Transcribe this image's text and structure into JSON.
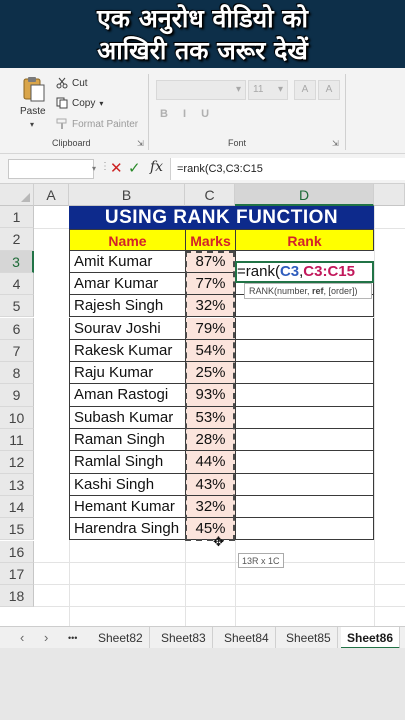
{
  "banner": {
    "line1": "एक अनुरोध वीडियो को",
    "line2": "आखिरी तक जरूर देखें"
  },
  "ribbon": {
    "paste_label": "Paste",
    "cut_label": "Cut",
    "copy_label": "Copy",
    "format_painter_label": "Format Painter",
    "clipboard_group": "Clipboard",
    "font_size": "11",
    "font_group": "Font",
    "font_icons": "B I U"
  },
  "formula_bar": {
    "formula": "=rank(C3,C3:C15",
    "fx_label": "fx"
  },
  "columns": [
    "A",
    "B",
    "C",
    "D"
  ],
  "rows": [
    "1",
    "2",
    "3",
    "4",
    "5",
    "6",
    "7",
    "8",
    "9",
    "10",
    "11",
    "12",
    "13",
    "14",
    "15",
    "16",
    "17",
    "18"
  ],
  "sheet": {
    "title": "USING RANK FUNCTION",
    "headers": {
      "name": "Name",
      "marks": "Marks",
      "rank": "Rank"
    },
    "records": [
      {
        "name": "Amit Kumar",
        "marks": "87%"
      },
      {
        "name": "Amar Kumar",
        "marks": "77%"
      },
      {
        "name": "Rajesh Singh",
        "marks": "32%"
      },
      {
        "name": "Sourav Joshi",
        "marks": "79%"
      },
      {
        "name": "Rakesk Kumar",
        "marks": "54%"
      },
      {
        "name": "Raju Kumar",
        "marks": "25%"
      },
      {
        "name": "Aman Rastogi",
        "marks": "93%"
      },
      {
        "name": "Subash Kumar",
        "marks": "53%"
      },
      {
        "name": "Raman Singh",
        "marks": "28%"
      },
      {
        "name": "Ramlal Singh",
        "marks": "44%"
      },
      {
        "name": "Kashi Singh",
        "marks": "43%"
      },
      {
        "name": "Hemant Kumar",
        "marks": "32%"
      },
      {
        "name": "Harendra Singh",
        "marks": "45%"
      }
    ],
    "active_formula": {
      "prefix": "=rank(",
      "ref1": "C3",
      "comma": ",",
      "ref2": "C3:C15"
    },
    "tooltip": {
      "fn": "RANK(number, ",
      "ref": "ref",
      "rest": ", [order])"
    },
    "selection_size": "13R x 1C"
  },
  "tabs": {
    "ellipsis": "•••",
    "sheets": [
      "Sheet82",
      "Sheet83",
      "Sheet84",
      "Sheet85",
      "Sheet86"
    ],
    "active": "Sheet86"
  },
  "colors": {
    "banner_bg": "#0d2f49",
    "title_bg": "#0d2a8c",
    "header_bg": "#ffff00",
    "header_text": "#d2232a",
    "marks_fill": "#fbe4dc",
    "excel_green": "#217346"
  }
}
